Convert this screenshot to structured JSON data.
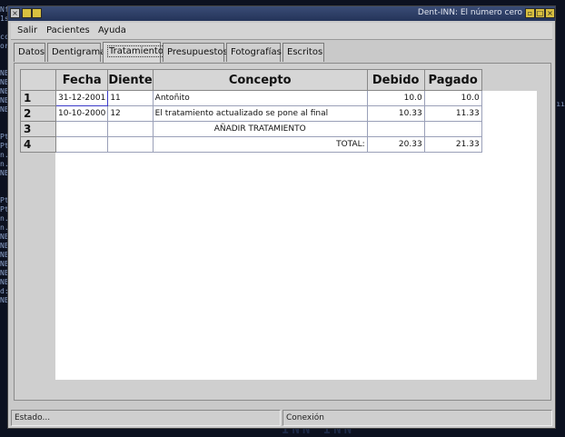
{
  "window": {
    "title": "Dent-INN: El número cero"
  },
  "menu": [
    "Salir",
    "Pacientes",
    "Ayuda"
  ],
  "tabs": [
    "Datos",
    "Dentigrama",
    "Tratamientos",
    "Presupuestos",
    "Fotografías",
    "Escritos"
  ],
  "active_tab": "Tratamientos",
  "table": {
    "headers": [
      "Fecha",
      "Diente",
      "Concepto",
      "Debido",
      "Pagado"
    ],
    "rows": [
      {
        "num": "1",
        "fecha": "31-12-2001",
        "diente": "11",
        "concepto": "Antoñito",
        "debido": "10.0",
        "pagado": "10.0"
      },
      {
        "num": "2",
        "fecha": "10-10-2000",
        "diente": "12",
        "concepto": "El tratamiento actualizado se pone al final",
        "debido": "10.33",
        "pagado": "11.33"
      },
      {
        "num": "3",
        "fecha": "",
        "diente": "",
        "concepto": "AÑADIR TRATAMIENTO",
        "debido": "",
        "pagado": ""
      },
      {
        "num": "4",
        "fecha": "",
        "diente": "",
        "concepto": "TOTAL:",
        "debido": "20.33",
        "pagado": "21.33"
      }
    ]
  },
  "status": {
    "left": "Estado...",
    "right": "Conexión"
  },
  "background": {
    "left_lines": "Nf\n1s\n\ncc\nor\n\n\nNE\nNE\nNE\nNE\nNE\n\n\nPt\nPt\nn.\nn.\nNE\n\n\nPt\nPt\nn.\nn.\nNE\nNE\nNE\nNE\nNE\nNE\nd:\nNE",
    "right_line": "ıı",
    "bottom_text": "INN INN"
  }
}
